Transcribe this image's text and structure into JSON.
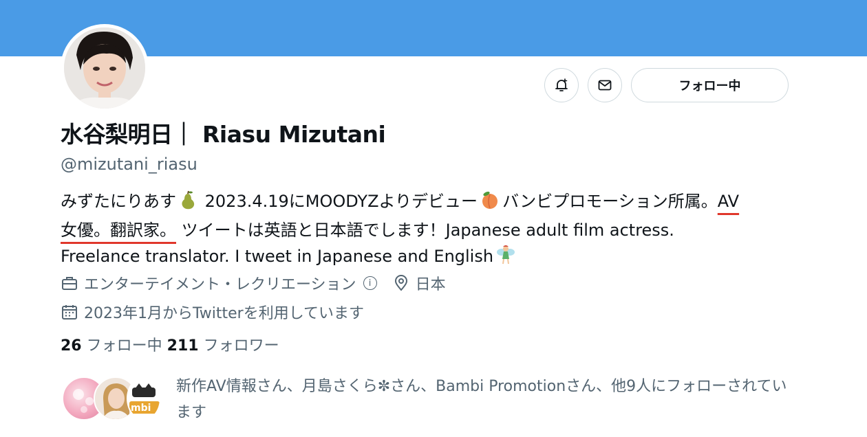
{
  "profile": {
    "name": "水谷梨明日｜ Riasu Mizutani",
    "handle": "@mizutani_riasu",
    "bio": {
      "part1": "みずたにりあす",
      "part2": " 2023.4.19にMOODYZよりデビュー",
      "part3": "バンビプロモーション所属。",
      "highlight": "AV女優。翻訳家。",
      "part4": " ツイートは英語と日本語でします！Japanese adult film actress. Freelance translator. I tweet in Japanese and English"
    },
    "category": "エンターテイメント・レクリエーション",
    "info_icon_label": "i",
    "location": "日本",
    "joined": "2023年1月からTwitterを利用しています"
  },
  "actions": {
    "follow_label": "フォロー中"
  },
  "counts": {
    "following_count": "26",
    "following_label": "フォロー中",
    "followers_count": "211",
    "followers_label": "フォロワー"
  },
  "followed_by": {
    "text": "新作AV情報さん、月島さくら✼さん、Bambi Promotionさん、他9人にフォローされています",
    "bambi_badge": "mbi"
  },
  "icons": {
    "notification": "bell-plus-icon",
    "message": "envelope-icon",
    "category": "briefcase-icon",
    "location": "location-pin-icon",
    "calendar": "calendar-icon",
    "emoji1": "pear-emoji-icon",
    "emoji2": "peach-emoji-icon",
    "emoji3": "fairy-emoji-icon"
  },
  "colors": {
    "banner": "#4a9be6",
    "underline": "#e0372b",
    "secondary_text": "#536471"
  }
}
